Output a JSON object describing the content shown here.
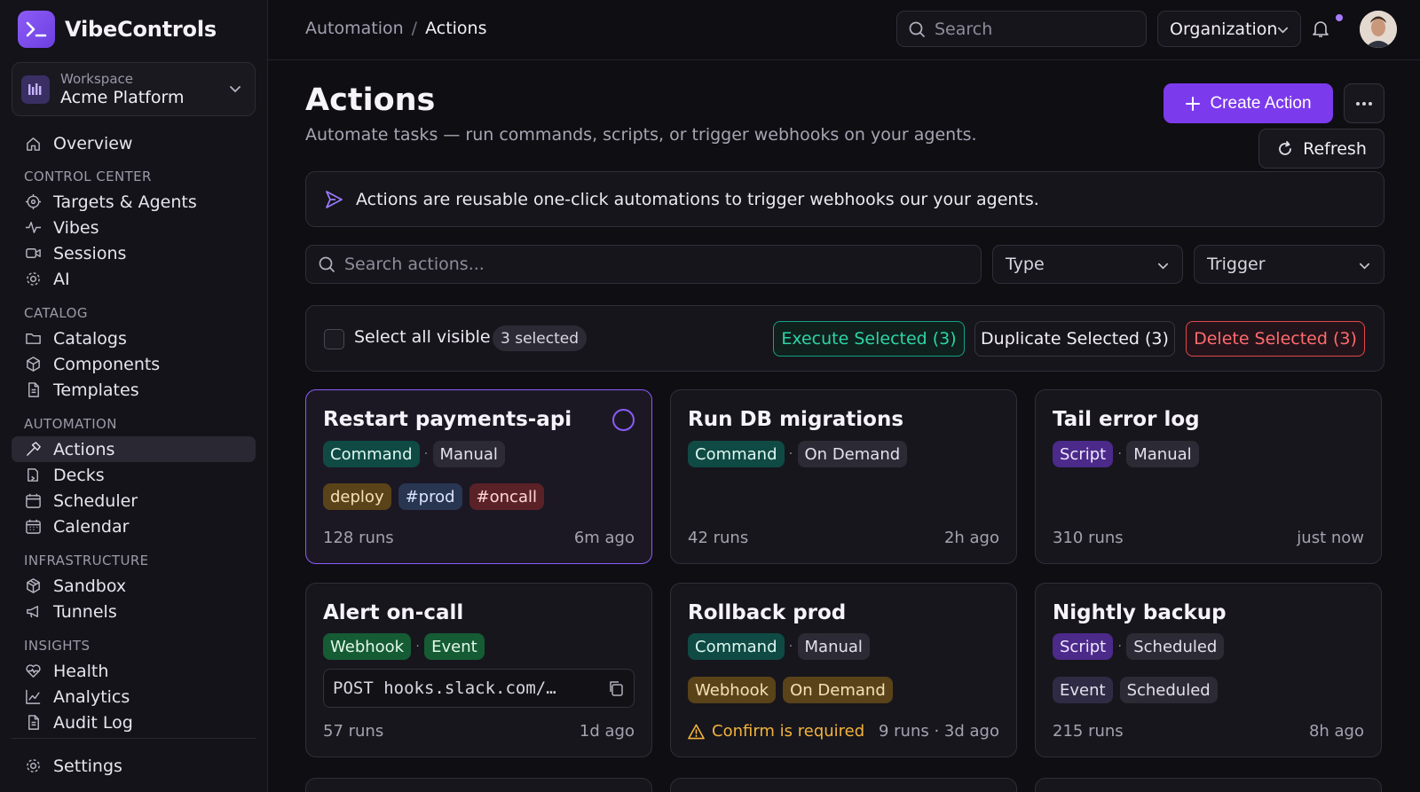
{
  "app": {
    "name": "VibeControls"
  },
  "workspace": {
    "label": "Workspace",
    "name": "Acme Platform"
  },
  "sidebar": {
    "top": [
      {
        "label": "Overview",
        "icon": "home-icon"
      }
    ],
    "sections": [
      {
        "title": "CONTROL CENTER",
        "items": [
          {
            "label": "Targets & Agents",
            "icon": "crosshair-icon"
          },
          {
            "label": "Vibes",
            "icon": "activity-icon"
          },
          {
            "label": "Sessions",
            "icon": "video-icon"
          },
          {
            "label": "AI",
            "icon": "cog-icon"
          }
        ]
      },
      {
        "title": "CATALOG",
        "items": [
          {
            "label": "Catalogs",
            "icon": "folder-icon"
          },
          {
            "label": "Components",
            "icon": "box-icon"
          },
          {
            "label": "Templates",
            "icon": "file-icon"
          }
        ]
      },
      {
        "title": "AUTOMATION",
        "items": [
          {
            "label": "Actions",
            "icon": "hammer-icon",
            "active": true
          },
          {
            "label": "Decks",
            "icon": "deck-icon"
          },
          {
            "label": "Scheduler",
            "icon": "calendar-icon"
          },
          {
            "label": "Calendar",
            "icon": "calendar-grid-icon"
          }
        ]
      },
      {
        "title": "INFRASTRUCTURE",
        "items": [
          {
            "label": "Sandbox",
            "icon": "cube-icon"
          },
          {
            "label": "Tunnels",
            "icon": "megaphone-icon"
          }
        ]
      },
      {
        "title": "INSIGHTS",
        "items": [
          {
            "label": "Health",
            "icon": "heart-pulse-icon"
          },
          {
            "label": "Analytics",
            "icon": "chart-line-icon"
          },
          {
            "label": "Audit Log",
            "icon": "document-icon"
          }
        ]
      }
    ],
    "footer": {
      "label": "Settings",
      "icon": "gear-icon"
    }
  },
  "topbar": {
    "breadcrumb_parent": "Automation",
    "breadcrumb_sep": "/",
    "breadcrumb_current": "Actions",
    "search_placeholder": "Search",
    "org_label": "Organization"
  },
  "page": {
    "title": "Actions",
    "subtitle": "Automate tasks — run commands, scripts, or trigger webhooks on your agents.",
    "create_label": "Create Action",
    "refresh_label": "Refresh",
    "banner": "Actions are reusable one-click automations to trigger webhooks our your agents."
  },
  "filters": {
    "search_placeholder": "Search actions...",
    "type_label": "Type",
    "trigger_label": "Trigger"
  },
  "bulk": {
    "select_all_label": "Select all visible",
    "selected_count": "3 selected",
    "execute_label": "Execute Selected (3)",
    "duplicate_label": "Duplicate Selected (3)",
    "delete_label": "Delete Selected (3)"
  },
  "cards": [
    {
      "title": "Restart payments-api",
      "type": "Command",
      "trigger": "Manual",
      "tags": [
        "deploy",
        "#prod",
        "#oncall"
      ],
      "runs": "128 runs",
      "time": "6m ago",
      "selected": true
    },
    {
      "title": "Run DB migrations",
      "type": "Command",
      "trigger": "On Demand",
      "runs": "42 runs",
      "time": "2h ago"
    },
    {
      "title": "Tail error log",
      "type": "Script",
      "trigger": "Manual",
      "runs": "310 runs",
      "time": "just now"
    },
    {
      "title": "Alert on-call",
      "type": "Webhook",
      "trigger": "Event",
      "webhook": "POST hooks.slack.com/…",
      "runs": "57 runs",
      "time": "1d ago"
    },
    {
      "title": "Rollback prod",
      "type": "Command",
      "trigger": "Manual",
      "tags": [
        "Webhook",
        "On Demand"
      ],
      "warning": "Confirm is required",
      "meta": "9 runs · 3d ago"
    },
    {
      "title": "Nightly backup",
      "type": "Script",
      "trigger": "Scheduled",
      "tags": [
        "Event",
        "Scheduled"
      ],
      "runs": "215 runs",
      "time": "8h ago"
    }
  ],
  "colors": {
    "accent": "#7c3aed",
    "success": "#2dd4a7",
    "danger": "#ff6b6e",
    "warning": "#f2b33d"
  }
}
